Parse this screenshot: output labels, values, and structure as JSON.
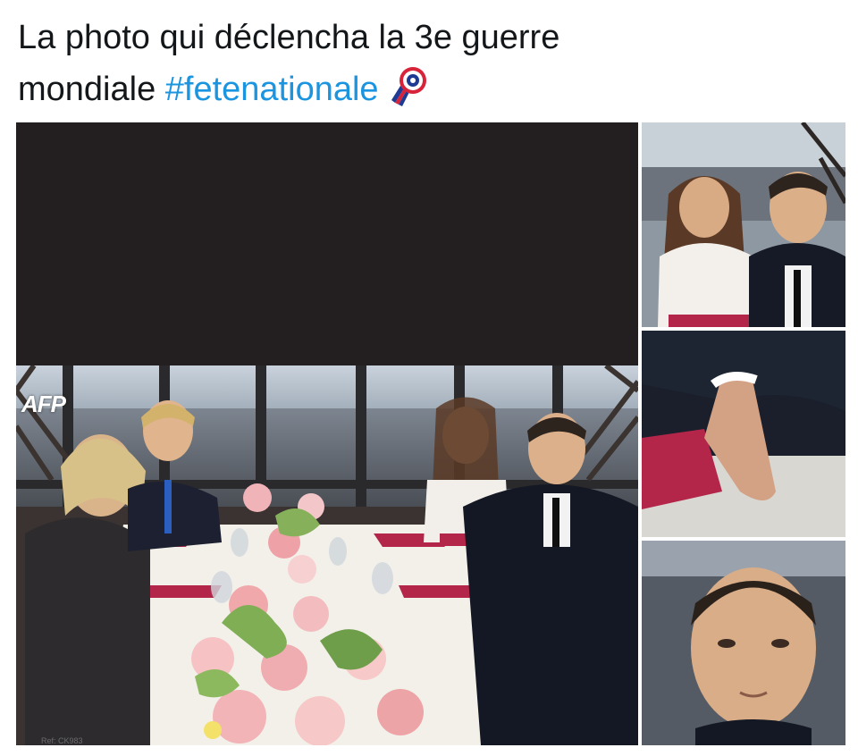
{
  "tweet": {
    "text_line1": "La photo qui déclencha la 3e guerre",
    "text_line2_prefix": "mondiale",
    "hashtag": "#fetenationale",
    "emoji_icon": "rosette-icon"
  },
  "media": {
    "main_photo": {
      "watermark": "AFP",
      "credit": "Ref: CK983"
    },
    "colors": {
      "hashtag": "#1b95e0",
      "band": "#231f20",
      "tablecloth_runner": "#b3264a"
    }
  }
}
